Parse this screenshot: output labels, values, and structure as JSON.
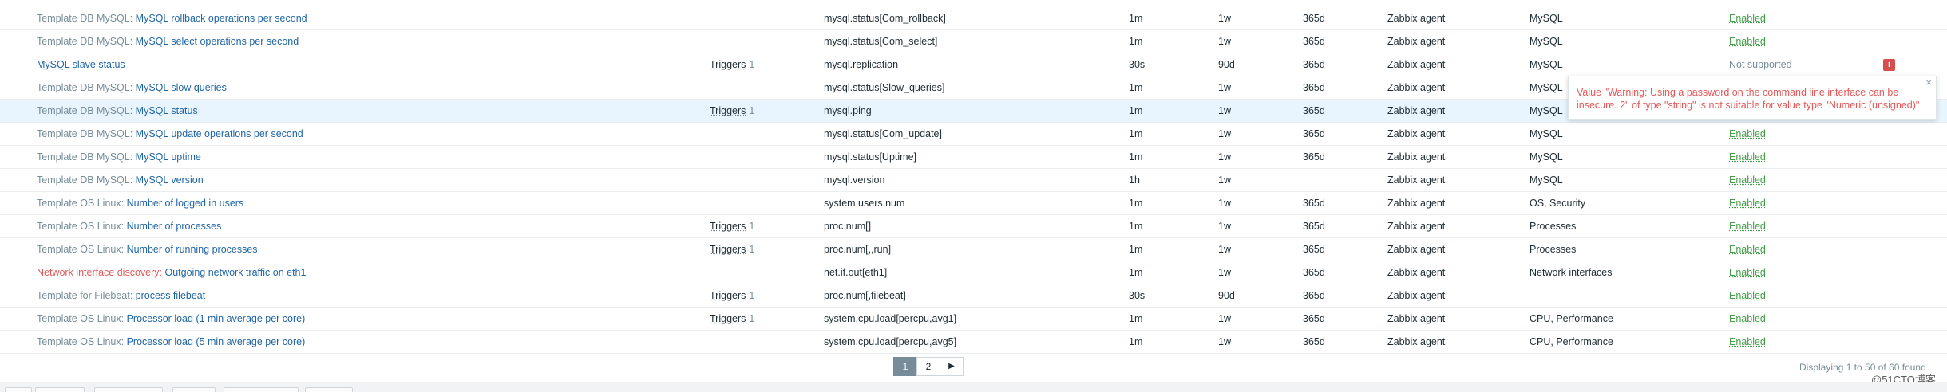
{
  "rows": [
    {
      "prefix": "Template DB MySQL:",
      "name": "MySQL rollback operations per second",
      "triggers": "",
      "trigger_count": "",
      "key": "mysql.status[Com_rollback]",
      "interval": "1m",
      "history": "1w",
      "trends": "365d",
      "type": "Zabbix agent",
      "applications": "MySQL",
      "status": "Enabled"
    },
    {
      "prefix": "Template DB MySQL:",
      "name": "MySQL select operations per second",
      "triggers": "",
      "trigger_count": "",
      "key": "mysql.status[Com_select]",
      "interval": "1m",
      "history": "1w",
      "trends": "365d",
      "type": "Zabbix agent",
      "applications": "MySQL",
      "status": "Enabled"
    },
    {
      "prefix": "",
      "name": "MySQL slave status",
      "triggers": "Triggers",
      "trigger_count": "1",
      "key": "mysql.replication",
      "interval": "30s",
      "history": "90d",
      "trends": "365d",
      "type": "Zabbix agent",
      "applications": "MySQL",
      "status": "Not supported"
    },
    {
      "prefix": "Template DB MySQL:",
      "name": "MySQL slow queries",
      "triggers": "",
      "trigger_count": "",
      "key": "mysql.status[Slow_queries]",
      "interval": "1m",
      "history": "1w",
      "trends": "365d",
      "type": "Zabbix agent",
      "applications": "MySQL",
      "status": ""
    },
    {
      "prefix": "Template DB MySQL:",
      "name": "MySQL status",
      "triggers": "Triggers",
      "trigger_count": "1",
      "key": "mysql.ping",
      "interval": "1m",
      "history": "1w",
      "trends": "365d",
      "type": "Zabbix agent",
      "applications": "MySQL",
      "status": ""
    },
    {
      "prefix": "Template DB MySQL:",
      "name": "MySQL update operations per second",
      "triggers": "",
      "trigger_count": "",
      "key": "mysql.status[Com_update]",
      "interval": "1m",
      "history": "1w",
      "trends": "365d",
      "type": "Zabbix agent",
      "applications": "MySQL",
      "status": "Enabled"
    },
    {
      "prefix": "Template DB MySQL:",
      "name": "MySQL uptime",
      "triggers": "",
      "trigger_count": "",
      "key": "mysql.status[Uptime]",
      "interval": "1m",
      "history": "1w",
      "trends": "365d",
      "type": "Zabbix agent",
      "applications": "MySQL",
      "status": "Enabled"
    },
    {
      "prefix": "Template DB MySQL:",
      "name": "MySQL version",
      "triggers": "",
      "trigger_count": "",
      "key": "mysql.version",
      "interval": "1h",
      "history": "1w",
      "trends": "",
      "type": "Zabbix agent",
      "applications": "MySQL",
      "status": "Enabled"
    },
    {
      "prefix": "Template OS Linux:",
      "name": "Number of logged in users",
      "triggers": "",
      "trigger_count": "",
      "key": "system.users.num",
      "interval": "1m",
      "history": "1w",
      "trends": "365d",
      "type": "Zabbix agent",
      "applications": "OS, Security",
      "status": "Enabled"
    },
    {
      "prefix": "Template OS Linux:",
      "name": "Number of processes",
      "triggers": "Triggers",
      "trigger_count": "1",
      "key": "proc.num[]",
      "interval": "1m",
      "history": "1w",
      "trends": "365d",
      "type": "Zabbix agent",
      "applications": "Processes",
      "status": "Enabled"
    },
    {
      "prefix": "Template OS Linux:",
      "name": "Number of running processes",
      "triggers": "Triggers",
      "trigger_count": "1",
      "key": "proc.num[,,run]",
      "interval": "1m",
      "history": "1w",
      "trends": "365d",
      "type": "Zabbix agent",
      "applications": "Processes",
      "status": "Enabled"
    },
    {
      "prefix": "Network interface discovery:",
      "prefix_red": true,
      "name": "Outgoing network traffic on eth1",
      "triggers": "",
      "trigger_count": "",
      "key": "net.if.out[eth1]",
      "interval": "1m",
      "history": "1w",
      "trends": "365d",
      "type": "Zabbix agent",
      "applications": "Network interfaces",
      "status": "Enabled"
    },
    {
      "prefix": "Template for Filebeat:",
      "name": "process filebeat",
      "triggers": "Triggers",
      "trigger_count": "1",
      "key": "proc.num[,filebeat]",
      "interval": "30s",
      "history": "90d",
      "trends": "365d",
      "type": "Zabbix agent",
      "applications": "",
      "status": "Enabled"
    },
    {
      "prefix": "Template OS Linux:",
      "name": "Processor load (1 min average per core)",
      "triggers": "Triggers",
      "trigger_count": "1",
      "key": "system.cpu.load[percpu,avg1]",
      "interval": "1m",
      "history": "1w",
      "trends": "365d",
      "type": "Zabbix agent",
      "applications": "CPU, Performance",
      "status": "Enabled"
    },
    {
      "prefix": "Template OS Linux:",
      "name": "Processor load (5 min average per core)",
      "triggers": "",
      "trigger_count": "",
      "key": "system.cpu.load[percpu,avg5]",
      "interval": "1m",
      "history": "1w",
      "trends": "365d",
      "type": "Zabbix agent",
      "applications": "CPU, Performance",
      "status": "Enabled"
    }
  ],
  "highlight_row": 4,
  "error_popup": {
    "message": "Value \"Warning: Using a password on the command line interface can be insecure. 2\" of type \"string\" is not suitable for value type \"Numeric (unsigned)\"",
    "close": "×"
  },
  "info_icon": {
    "glyph": "i"
  },
  "pagination": {
    "pages": [
      "1",
      "2"
    ],
    "active": "1",
    "next": "▶"
  },
  "displaying": "Displaying 1 to 50 of 60 found",
  "watermark": "@51CTO博客",
  "colors": {
    "link": "#1f65a6",
    "enabled": "#429e47",
    "error": "#e45959",
    "muted": "#768d99"
  }
}
